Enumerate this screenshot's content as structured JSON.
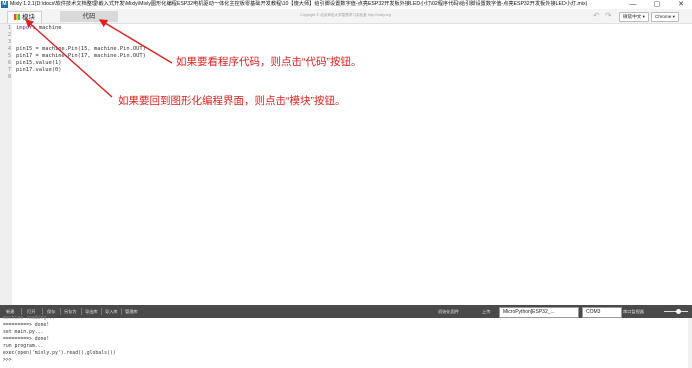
{
  "window": {
    "app_icon": "M",
    "title": "Mixly 1.2.1(D:\\docs\\软件技术文档整理\\嵌入式开发\\Mixly\\Mixly图形化编程ESP32电机驱动一体化主控板零基础开发教程\\10【傻大师】给引脚设置数字值-点亮ESP32开发板外接LED小灯\\02程序代码\\给引脚设置数字值-点亮ESP32开发板外接LED小灯.mix)",
    "minimize": "—",
    "maximize": "▢",
    "close": "✕"
  },
  "toolbar": {
    "tab_blocks": "模块",
    "tab_code": "代码",
    "copyright": "Copyright © 北京师范大学智慧学习实验室 http://mixly.org",
    "undo": "↶",
    "redo": "↷",
    "font_select": "微软中文 ▾",
    "browser_select": "Chrome ▾"
  },
  "editor": {
    "line_numbers": [
      "1",
      "2",
      "3",
      "4",
      "5",
      "6",
      "7",
      "8"
    ],
    "lines": [
      {
        "kw": "import",
        "rest": " machine"
      },
      {
        "kw": "",
        "rest": ""
      },
      {
        "kw": "",
        "rest": ""
      },
      {
        "kw": "",
        "rest": "pin15 = machine.Pin(15, machine.Pin.OUT)"
      },
      {
        "kw": "",
        "rest": "pin17 = machine.Pin(17, machine.Pin.OUT)"
      },
      {
        "kw": "",
        "rest": "pin15.value(1)"
      },
      {
        "kw": "",
        "rest": "pin17.value(0)"
      },
      {
        "kw": "",
        "rest": ""
      }
    ]
  },
  "annotations": {
    "code_hint": "如果要看程序代码，则点击“代码”按钮。",
    "blocks_hint": "如果要回到图形化编程界面，则点击“模块”按钮。"
  },
  "bottombar": {
    "buttons": [
      "新建",
      "打开",
      "保存",
      "另存为",
      "导出库",
      "导入库",
      "管理库"
    ],
    "init_firmware": "初始化固件",
    "upload": "上传",
    "board_select": "MicroPython[ESP32_...",
    "port_select": "COM3",
    "serial_monitor": "串口监视器"
  },
  "console": {
    "lines": [
      "machine reading...",
      "=========> done!",
      "set main.py...",
      "=========> done!",
      "run program...",
      "exec(open('mixly.py').read(),globals())",
      ">>>"
    ]
  },
  "colors": {
    "annotation": "#e02020",
    "bottombar": "#4a4a4a",
    "keyword": "#7a2ea8"
  }
}
